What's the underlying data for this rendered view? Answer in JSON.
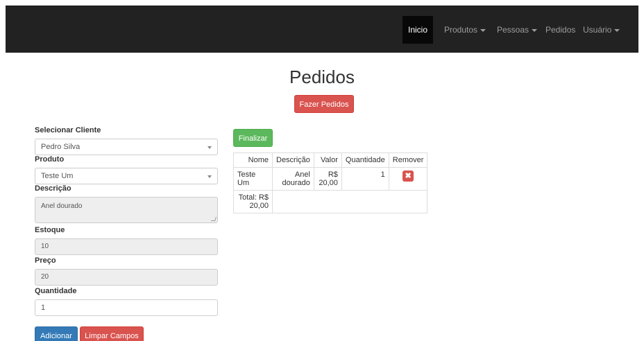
{
  "nav": {
    "items": [
      {
        "label": "Inicio",
        "active": true,
        "caret": false
      },
      {
        "label": "Produtos",
        "active": false,
        "caret": true
      },
      {
        "label": "Pessoas",
        "active": false,
        "caret": true
      },
      {
        "label": "Pedidos",
        "active": false,
        "caret": false
      },
      {
        "label": "Usuário",
        "active": false,
        "caret": true
      }
    ]
  },
  "page": {
    "title": "Pedidos",
    "fazer_pedidos_label": "Fazer Pedidos"
  },
  "form": {
    "cliente_label": "Selecionar Cliente",
    "cliente_value": "Pedro Silva",
    "produto_label": "Produto",
    "produto_value": "Teste Um",
    "descricao_label": "Descrição",
    "descricao_value": "Anel dourado",
    "estoque_label": "Estoque",
    "estoque_value": "10",
    "preco_label": "Preço",
    "preco_value": "20",
    "quantidade_label": "Quantidade",
    "quantidade_value": "1",
    "adicionar_label": "Adicionar",
    "limpar_label": "Limpar Campos"
  },
  "order": {
    "finalizar_label": "Finalizar",
    "headers": [
      "Nome",
      "Descrição",
      "Valor",
      "Quantidade",
      "Remover"
    ],
    "rows": [
      {
        "nome": "Teste Um",
        "descricao_line1": "Anel",
        "descricao_line2": "dourado",
        "valor_line1": "R$",
        "valor_line2": "20,00",
        "quantidade": "1",
        "remove_icon": "x-icon"
      }
    ],
    "total_line1": "Total: R$",
    "total_line2": "20,00"
  },
  "colors": {
    "navbar": "#222222",
    "danger": "#d9534f",
    "success": "#5cb85c",
    "primary": "#337ab7"
  }
}
